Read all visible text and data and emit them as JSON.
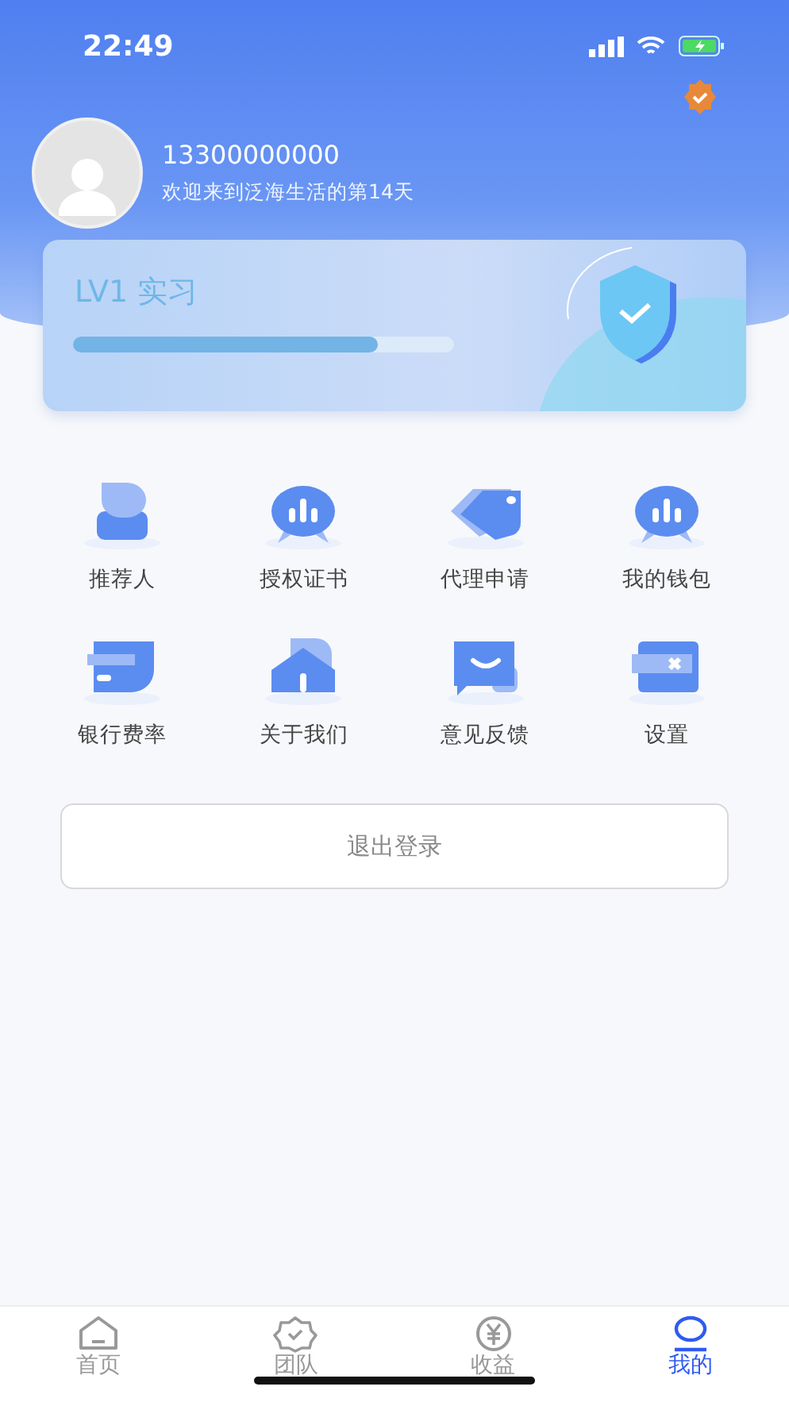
{
  "status_bar": {
    "time": "22:49"
  },
  "profile": {
    "phone": "13300000000",
    "welcome": "欢迎来到泛海生活的第14天"
  },
  "level_card": {
    "title": "LV1 实习",
    "level": 0.8
  },
  "menu": [
    {
      "label": "推荐人",
      "kind": "person"
    },
    {
      "label": "授权证书",
      "kind": "chart"
    },
    {
      "label": "代理申请",
      "kind": "tag"
    },
    {
      "label": "我的钱包",
      "kind": "chart"
    },
    {
      "label": "银行费率",
      "kind": "card"
    },
    {
      "label": "关于我们",
      "kind": "house"
    },
    {
      "label": "意见反馈",
      "kind": "chat"
    },
    {
      "label": "设置",
      "kind": "wallet"
    }
  ],
  "logout_button": "退出登录",
  "tab_bar": [
    {
      "label": "首页",
      "kind": "home",
      "selected": false
    },
    {
      "label": "团队",
      "kind": "badge",
      "selected": false
    },
    {
      "label": "收益",
      "kind": "yen",
      "selected": false
    },
    {
      "label": "我的",
      "kind": "person",
      "selected": true
    }
  ]
}
